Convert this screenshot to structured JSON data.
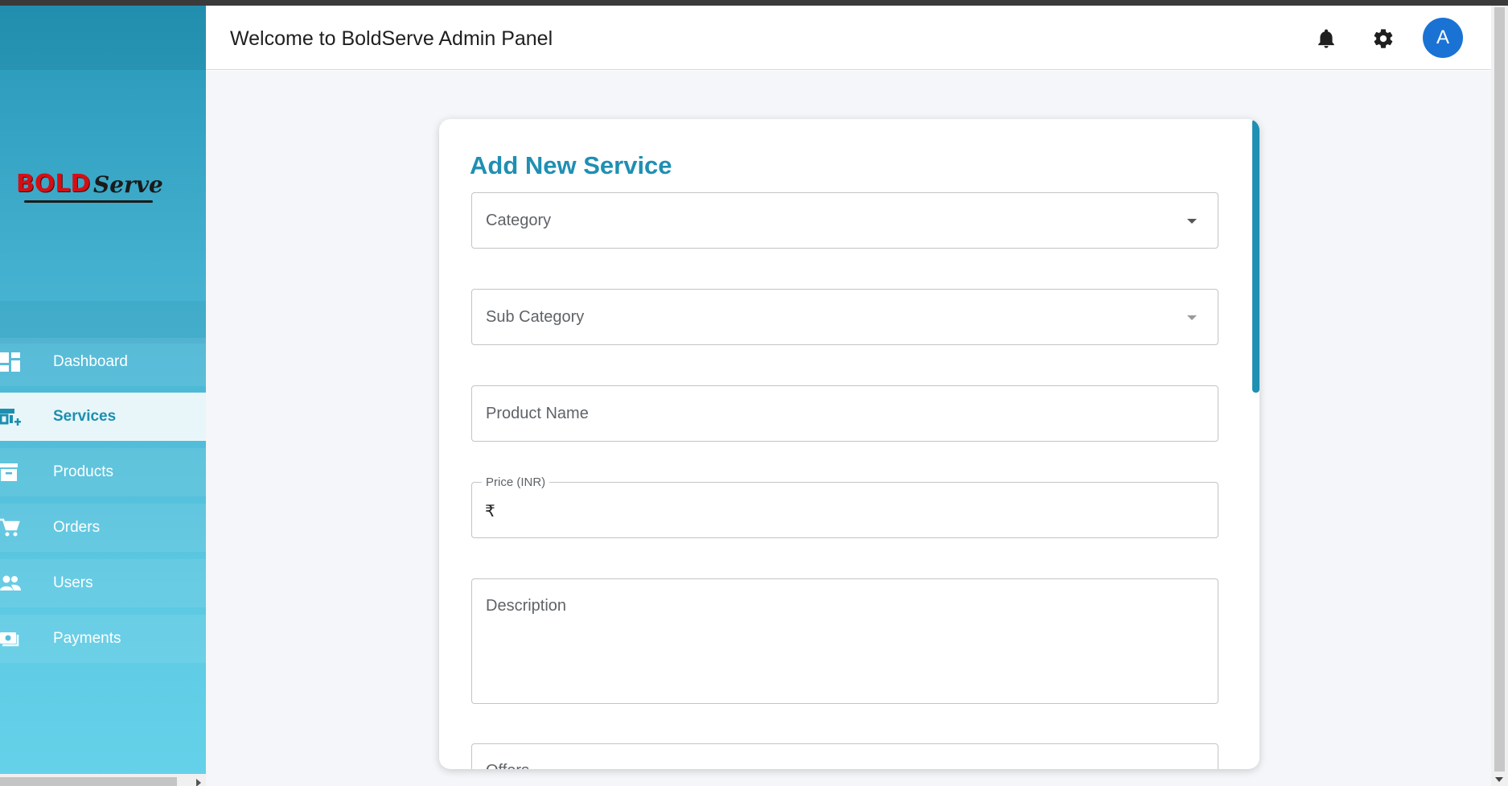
{
  "header": {
    "title": "Welcome to BoldServe Admin Panel",
    "avatar_letter": "A",
    "icons": [
      "bell-icon",
      "gear-icon"
    ]
  },
  "brand": {
    "logo_part1": "BOLD",
    "logo_part2": "Serve",
    "logo_colors": {
      "bold": "#d40f14",
      "serve": "#1a1a1a"
    }
  },
  "sidebar": {
    "items": [
      {
        "label": "Dashboard",
        "icon": "dashboard-icon",
        "active": false
      },
      {
        "label": "Services",
        "icon": "storefront-add-icon",
        "active": true
      },
      {
        "label": "Products",
        "icon": "archive-box-icon",
        "active": false
      },
      {
        "label": "Orders",
        "icon": "cart-icon",
        "active": false
      },
      {
        "label": "Users",
        "icon": "users-icon",
        "active": false
      },
      {
        "label": "Payments",
        "icon": "money-icon",
        "active": false
      }
    ]
  },
  "form": {
    "title": "Add New Service",
    "category_placeholder": "Category",
    "subcategory_placeholder": "Sub Category",
    "product_name_placeholder": "Product Name",
    "price_label": "Price (INR)",
    "price_prefix": "₹",
    "description_placeholder": "Description",
    "offers_placeholder": "Offers"
  },
  "colors": {
    "accent": "#1f8fb3",
    "avatar": "#1a73d4",
    "sidebar_top": "#2797b8",
    "sidebar_bottom": "#66d2ea",
    "page_bg": "#f4f6f9"
  }
}
